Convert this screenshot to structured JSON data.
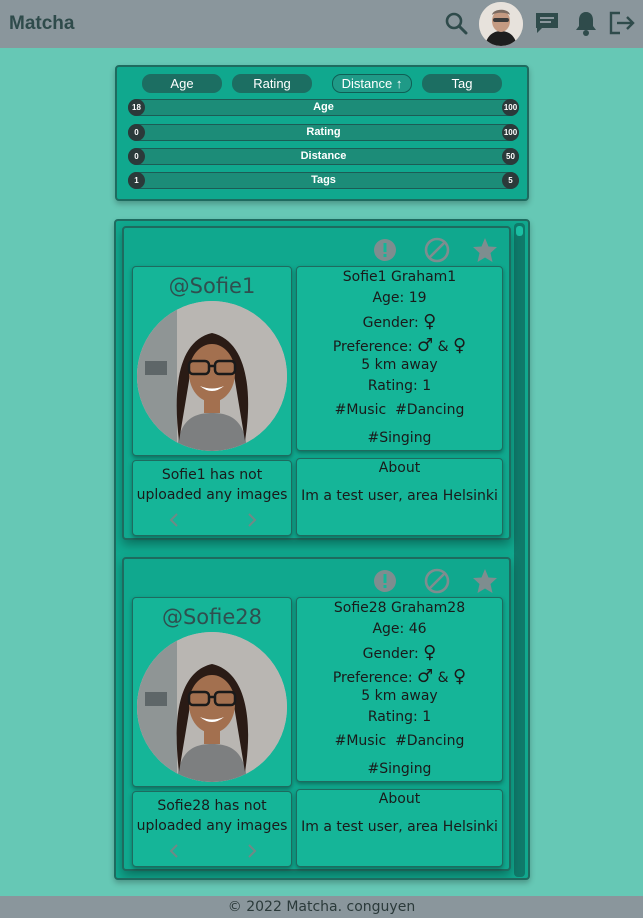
{
  "app": {
    "title": "Matcha"
  },
  "header": {
    "icons": [
      "search-icon",
      "avatar",
      "chat-icon",
      "bell-icon",
      "logout-icon"
    ]
  },
  "filters": {
    "sort_buttons": [
      {
        "label": "Age",
        "active": false
      },
      {
        "label": "Rating",
        "active": false
      },
      {
        "label": "Distance ↑",
        "active": true
      },
      {
        "label": "Tag",
        "active": false
      }
    ],
    "sliders": [
      {
        "label": "Age",
        "min": "18",
        "max": "100"
      },
      {
        "label": "Rating",
        "min": "0",
        "max": "100"
      },
      {
        "label": "Distance",
        "min": "0",
        "max": "50"
      },
      {
        "label": "Tags",
        "min": "1",
        "max": "5"
      }
    ]
  },
  "profiles": [
    {
      "username": "@Sofie1",
      "name": "Sofie1 Graham1",
      "age": "Age: 19",
      "gender_label": "Gender:",
      "preference_label": "Preference:",
      "preference_join": "&",
      "distance": "5 km away",
      "rating": "Rating: 1",
      "tags_line1": "#Music  #Dancing",
      "tags_line2": "#Singing",
      "no_images": "Sofie1 has not uploaded any images",
      "about_title": "About",
      "about_text": "Im a test user, area Helsinki"
    },
    {
      "username": "@Sofie28",
      "name": "Sofie28 Graham28",
      "age": "Age: 46",
      "gender_label": "Gender:",
      "preference_label": "Preference:",
      "preference_join": "&",
      "distance": "5 km away",
      "rating": "Rating: 1",
      "tags_line1": "#Music  #Dancing",
      "tags_line2": "#Singing",
      "no_images": "Sofie28 has not uploaded any images",
      "about_title": "About",
      "about_text": "Im a test user, area Helsinki"
    }
  ],
  "footer": {
    "text": "© 2022 Matcha. conguyen"
  },
  "colors": {
    "background": "#66c8b5",
    "panel": "#10a88e",
    "header": "#8a969c",
    "dark_teal": "#1c6e62"
  }
}
